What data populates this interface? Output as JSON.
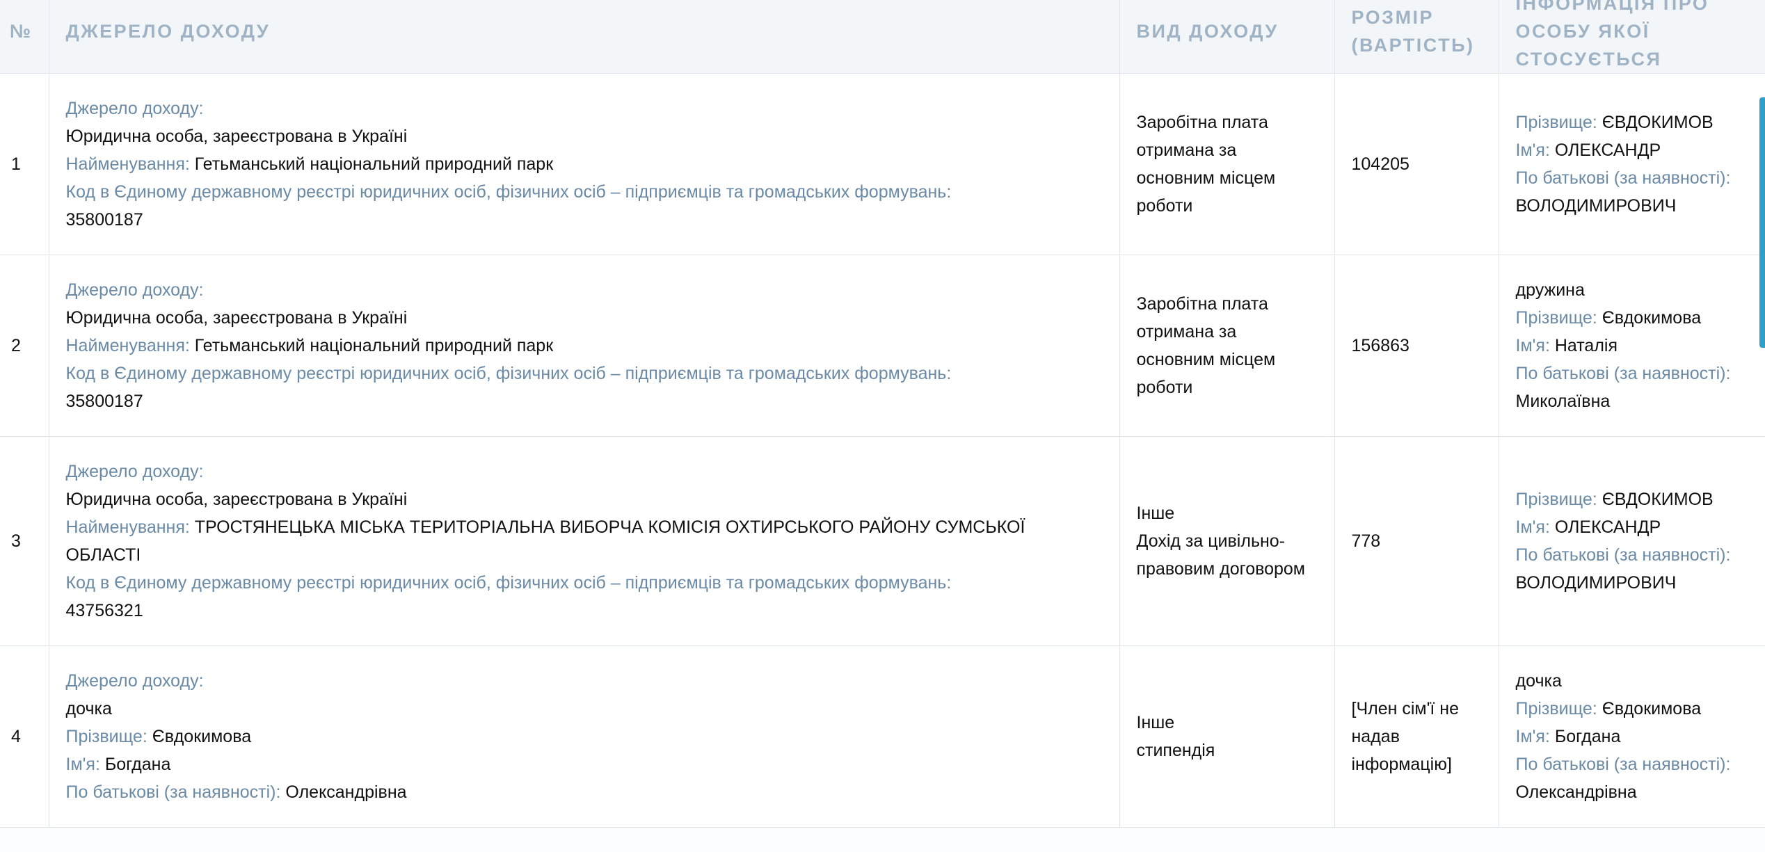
{
  "table": {
    "headers": {
      "num": "№",
      "source": "ДЖЕРЕЛО ДОХОДУ",
      "type": "ВИД ДОХОДУ",
      "amount": "РОЗМІР (ВАРТІСТЬ)",
      "person": "ІНФОРМАЦІЯ ПРО ОСОБУ ЯКОЇ СТОСУЄТЬСЯ"
    },
    "labels": {
      "source": "Джерело доходу:",
      "name": "Найменування:",
      "code": "Код в Єдиному державному реєстрі юридичних осіб, фізичних осіб – підприємців та громадських формувань:",
      "surname": "Прізвище:",
      "firstname": "Ім'я:",
      "patronymic": "По батькові (за наявності):"
    },
    "rows": [
      {
        "num": "1",
        "source_kind": "Юридична особа, зареєстрована в Україні",
        "source_name": "Гетьманський національний природний парк",
        "source_code": "35800187",
        "type_line1": "Заробітна плата отримана за основним місцем роботи",
        "amount": "104205",
        "person_surname": "ЄВДОКИМОВ",
        "person_firstname": "ОЛЕКСАНДР",
        "person_patronymic": "ВОЛОДИМИРОВИЧ"
      },
      {
        "num": "2",
        "source_kind": "Юридична особа, зареєстрована в Україні",
        "source_name": "Гетьманський національний природний парк",
        "source_code": "35800187",
        "type_line1": "Заробітна плата отримана за основним місцем роботи",
        "amount": "156863",
        "person_relation": "дружина",
        "person_surname": "Євдокимова",
        "person_firstname": "Наталія",
        "person_patronymic": "Миколаївна"
      },
      {
        "num": "3",
        "source_kind": "Юридична особа, зареєстрована в Україні",
        "source_name": "ТРОСТЯНЕЦЬКА МІСЬКА ТЕРИТОРІАЛЬНА ВИБОРЧА КОМІСІЯ ОХТИРСЬКОГО РАЙОНУ СУМСЬКОЇ ОБЛАСТІ",
        "source_code": "43756321",
        "type_line1": "Інше",
        "type_line2": "Дохід за цивільно-правовим договором",
        "amount": "778",
        "person_surname": "ЄВДОКИМОВ",
        "person_firstname": "ОЛЕКСАНДР",
        "person_patronymic": "ВОЛОДИМИРОВИЧ"
      },
      {
        "num": "4",
        "source_relation": "дочка",
        "source_surname": "Євдокимова",
        "source_firstname": "Богдана",
        "source_patronymic": "Олександрівна",
        "type_line1": "Інше",
        "type_line2": "стипендія",
        "amount": "[Член сім'ї не надав інформацію]",
        "person_relation": "дочка",
        "person_surname": "Євдокимова",
        "person_firstname": "Богдана",
        "person_patronymic": "Олександрівна"
      }
    ]
  },
  "colors": {
    "header_bg": "#f3f6f9",
    "header_text": "#9fb3c5",
    "label_text": "#6b8aa6",
    "border": "#dfe5ea",
    "scroll_accent": "#2f9fc9"
  }
}
